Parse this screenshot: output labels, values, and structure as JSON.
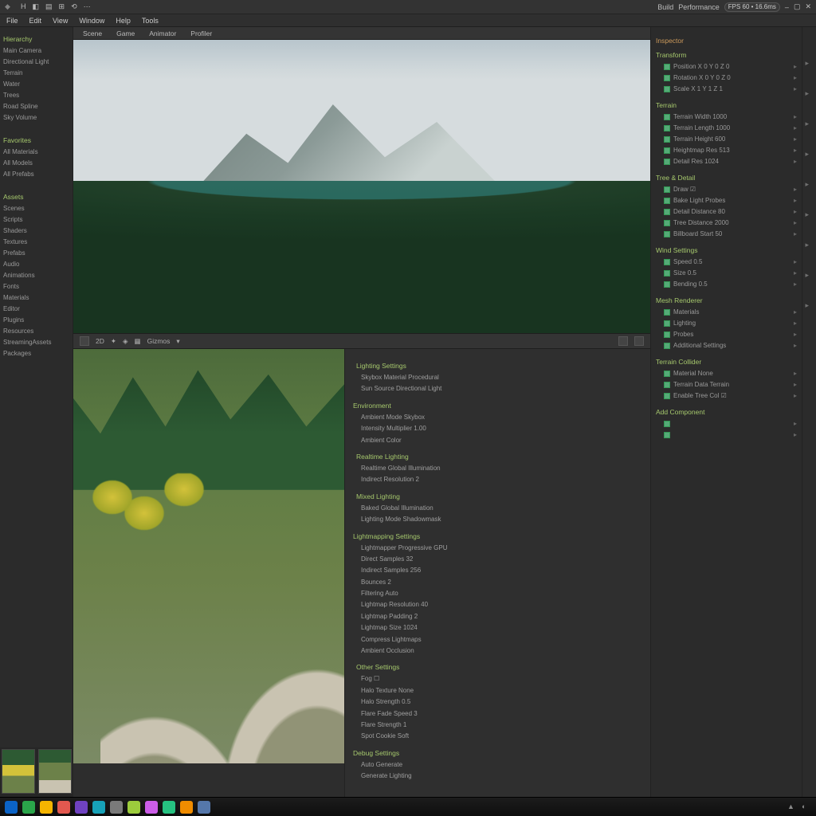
{
  "titlebar": {
    "left_items": [
      "H",
      "◧",
      "▤",
      "⊞",
      "⟲",
      "⋯"
    ],
    "right_items": [
      "Build",
      "Performance"
    ],
    "badge": "FPS  60 • 16.6ms",
    "window_controls": [
      "–",
      "▢",
      "✕"
    ]
  },
  "menubar": {
    "items": [
      "File",
      "Edit",
      "View",
      "Window",
      "Help",
      "Tools"
    ]
  },
  "left_panel": {
    "header1": "Hierarchy",
    "items1": [
      "Main Camera",
      "Directional Light",
      "Terrain",
      "Water",
      "Trees",
      "Road Spline",
      "Sky Volume"
    ],
    "header2": "Favorites",
    "items2": [
      "All Materials",
      "All Models",
      "All Prefabs"
    ],
    "header3": "Assets",
    "items3": [
      "Scenes",
      "Scripts",
      "Shaders",
      "Textures",
      "Prefabs",
      "Audio",
      "Animations",
      "Fonts",
      "Materials",
      "Editor",
      "Plugins",
      "Resources",
      "StreamingAssets",
      "Packages"
    ]
  },
  "tabs": {
    "items": [
      "Scene",
      "Game",
      "Animator",
      "Profiler"
    ]
  },
  "toolbar2": {
    "items": [
      "2D",
      "✦",
      "◈",
      "▦",
      "Gizmos",
      "▾"
    ]
  },
  "info_panel": {
    "sections": [
      {
        "title": "Lighting Settings",
        "rows": [
          "Skybox Material        Procedural",
          "Sun Source             Directional Light"
        ]
      },
      {
        "title": "Environment",
        "rows": [
          "Ambient Mode           Skybox",
          "Intensity Multiplier   1.00",
          "Ambient Color"
        ]
      },
      {
        "title": "Realtime Lighting",
        "rows": [
          "Realtime Global Illumination",
          "Indirect Resolution    2"
        ]
      },
      {
        "title": "Mixed Lighting",
        "rows": [
          "Baked Global Illumination",
          "Lighting Mode          Shadowmask"
        ]
      },
      {
        "title": "Lightmapping Settings",
        "rows": [
          "Lightmapper            Progressive GPU",
          "Direct Samples         32",
          "Indirect Samples       256",
          "Bounces                2",
          "Filtering              Auto",
          "Lightmap Resolution    40",
          "Lightmap Padding       2",
          "Lightmap Size          1024",
          "Compress Lightmaps",
          "Ambient Occlusion"
        ]
      },
      {
        "title": "Other Settings",
        "rows": [
          "Fog                    ☐",
          "Halo Texture           None",
          "Halo Strength          0.5",
          "Flare Fade Speed       3",
          "Flare Strength         1",
          "Spot Cookie            Soft"
        ]
      },
      {
        "title": "Debug Settings",
        "rows": [
          "Auto Generate",
          "Generate Lighting"
        ]
      }
    ]
  },
  "right_panel": {
    "header": "Inspector",
    "groups": [
      {
        "title": "Transform",
        "rows": [
          "Position   X 0  Y 0  Z 0",
          "Rotation   X 0  Y 0  Z 0",
          "Scale      X 1  Y 1  Z 1"
        ]
      },
      {
        "title": "Terrain",
        "rows": [
          "Terrain Width   1000",
          "Terrain Length  1000",
          "Terrain Height  600",
          "Heightmap Res   513",
          "Detail Res      1024"
        ]
      },
      {
        "title": "Tree & Detail",
        "rows": [
          "Draw            ☑",
          "Bake Light Probes",
          "Detail Distance 80",
          "Tree Distance   2000",
          "Billboard Start 50"
        ]
      },
      {
        "title": "Wind Settings",
        "rows": [
          "Speed    0.5",
          "Size     0.5",
          "Bending  0.5"
        ]
      },
      {
        "title": "Mesh Renderer",
        "rows": [
          "Materials",
          "Lighting",
          "Probes",
          "Additional Settings"
        ]
      },
      {
        "title": "Terrain Collider",
        "rows": [
          "Material        None",
          "Terrain Data    Terrain",
          "Enable Tree Col ☑"
        ]
      },
      {
        "title": "Add Component",
        "rows": [
          "",
          ""
        ]
      }
    ]
  },
  "taskbar": {
    "apps": [
      "#0b63c6",
      "#2aa54a",
      "#f4b400",
      "#e2584f",
      "#6f42c1",
      "#17a2b8",
      "#7a7a7a",
      "#9ccc3c",
      "#cc5de8",
      "#26c281",
      "#f08c00",
      "#5577aa"
    ]
  }
}
